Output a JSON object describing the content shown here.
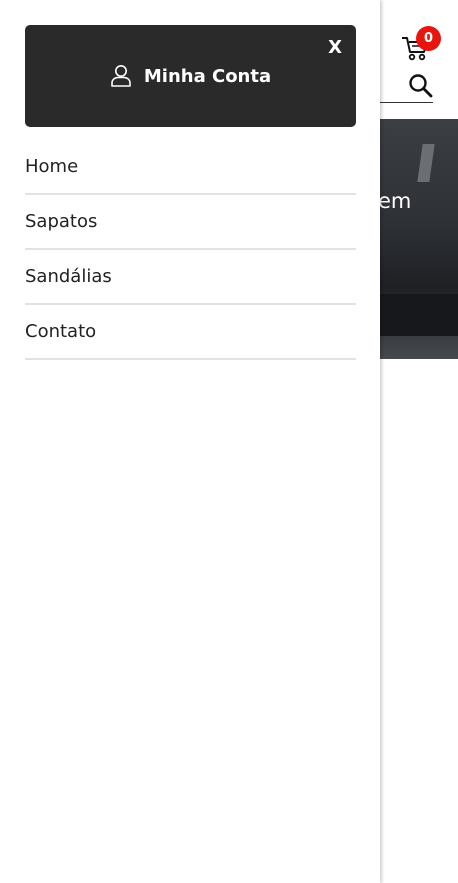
{
  "header": {
    "cart_count": "0"
  },
  "banner": {
    "text_fragment": "em"
  },
  "drawer": {
    "close_label": "X",
    "account_label": "Minha Conta",
    "menu": [
      {
        "label": "Home"
      },
      {
        "label": "Sapatos"
      },
      {
        "label": "Sandálias"
      },
      {
        "label": "Contato"
      }
    ]
  },
  "colors": {
    "account_box_bg": "#2a2a2a",
    "badge": "#e8150f",
    "divider": "#e2e2e2"
  }
}
